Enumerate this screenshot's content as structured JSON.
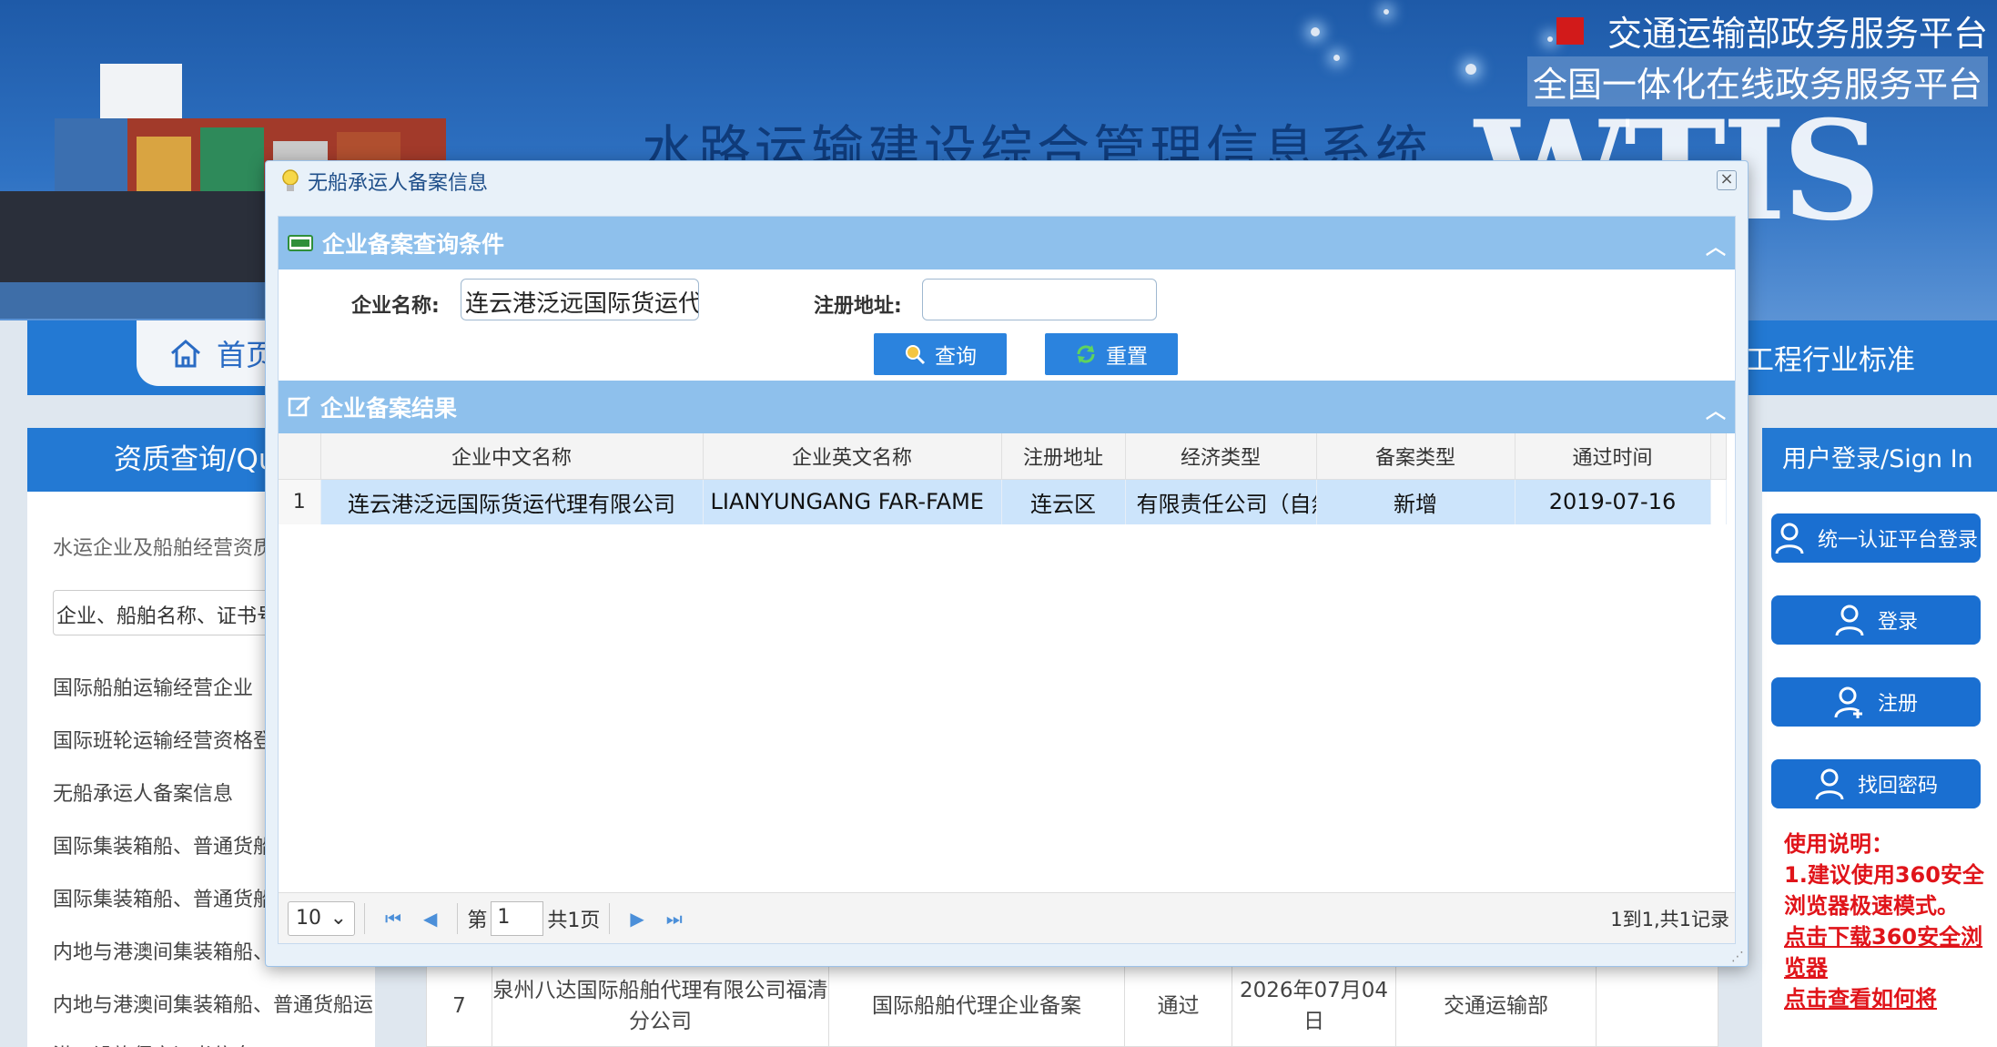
{
  "header": {
    "gov_line1": "交通运输部政务服务平台",
    "gov_line2": "全国一体化在线政务服务平台",
    "system_title": "水路运输建设综合管理信息系统",
    "system_logo": "WTIS",
    "brand_red": "#d21a1a",
    "brand_blue": "#2379d3"
  },
  "nav": {
    "home_label": "首页",
    "right_label": "工程行业标准"
  },
  "left_panel": {
    "title": "资质查询/Query",
    "subtitle": "水运企业及船舶经营资质查询",
    "search_placeholder": "企业、船舶名称、证书号",
    "items": [
      "国际船舶运输经营企业",
      "国际班轮运输经营资格登记",
      "无船承运人备案信息",
      "国际集装箱船、普通货船运输",
      "国际集装箱船、普通货船运输",
      "内地与港澳间集装箱船、普通",
      "内地与港澳间集装箱船、普通货船运",
      "港口设施保安证书信息"
    ]
  },
  "right_panel": {
    "title": "用户登录/Sign In",
    "buttons": [
      "统一认证平台登录",
      "登录",
      "注册",
      "找回密码"
    ],
    "notes_title": "使用说明：",
    "notes_1": "1.建议使用360安全浏览器极速模式。",
    "notes_link1": "点击下载360安全浏览器",
    "notes_link2": "点击查看如何将"
  },
  "bg_table_row": {
    "index": "7",
    "name": "泉州八达国际船舶代理有限公司福清分公司",
    "type": "国际船舶代理企业备案",
    "status": "通过",
    "date": "2026年07月04日",
    "authority": "交通运输部"
  },
  "dialog": {
    "title": "无船承运人备案信息",
    "query_section_title": "企业备案查询条件",
    "company_name_label": "企业名称:",
    "company_name_value": "连云港泛远国际货运代",
    "address_label": "注册地址:",
    "address_value": "",
    "search_button": "查询",
    "reset_button": "重置",
    "result_section_title": "企业备案结果",
    "columns": [
      "企业中文名称",
      "企业英文名称",
      "注册地址",
      "经济类型",
      "备案类型",
      "通过时间"
    ],
    "rows": [
      {
        "index": "1",
        "cn_name": "连云港泛远国际货运代理有限公司",
        "en_name": "LIANYUNGANG FAR-FAME",
        "address": "连云区",
        "econ_type": "有限责任公司（自然",
        "record_type": "新增",
        "pass_date": "2019-07-16"
      }
    ],
    "pager": {
      "page_size": "10",
      "page_prefix": "第",
      "page_value": "1",
      "page_total": "共1页",
      "summary": "1到1,共1记录"
    }
  }
}
